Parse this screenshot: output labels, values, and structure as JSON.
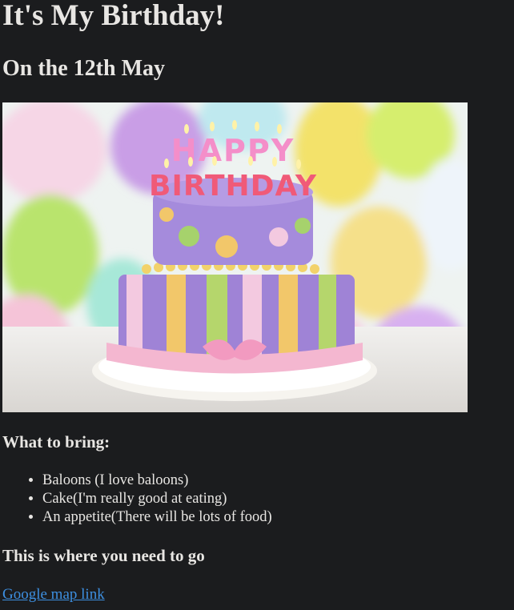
{
  "page": {
    "title": "It's My Birthday!",
    "subtitle": "On the 12th May"
  },
  "image": {
    "cake_lettering_top": "HAPPY",
    "cake_lettering_bottom": "BIRTHDAY"
  },
  "bring": {
    "heading": "What to bring:",
    "items": [
      "Baloons (I love baloons)",
      "Cake(I'm really good at eating)",
      "An appetite(There will be lots of food)"
    ]
  },
  "location": {
    "heading": "This is where you need to go",
    "link_label": "Google map link"
  },
  "colors": {
    "background": "#1b1c1e",
    "text": "#e8e6e3",
    "link": "#3d8fe0"
  }
}
